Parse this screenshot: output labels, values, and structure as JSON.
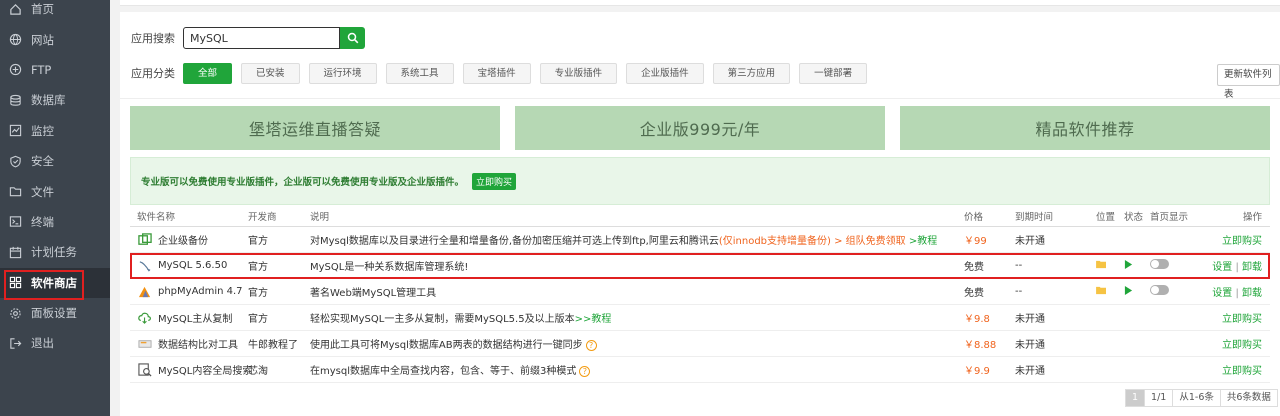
{
  "sidebar": {
    "items": [
      {
        "label": "首页",
        "icon": "home-icon"
      },
      {
        "label": "网站",
        "icon": "globe-icon"
      },
      {
        "label": "FTP",
        "icon": "ftp-icon"
      },
      {
        "label": "数据库",
        "icon": "database-icon"
      },
      {
        "label": "监控",
        "icon": "monitor-icon"
      },
      {
        "label": "安全",
        "icon": "shield-icon"
      },
      {
        "label": "文件",
        "icon": "folder-icon"
      },
      {
        "label": "终端",
        "icon": "terminal-icon"
      },
      {
        "label": "计划任务",
        "icon": "calendar-icon"
      },
      {
        "label": "软件商店",
        "icon": "grid-icon",
        "active": true
      },
      {
        "label": "面板设置",
        "icon": "gear-icon"
      },
      {
        "label": "退出",
        "icon": "logout-icon"
      }
    ]
  },
  "search": {
    "label": "应用搜索",
    "value": "MySQL"
  },
  "categories": {
    "label": "应用分类",
    "items": [
      "全部",
      "已安装",
      "运行环境",
      "系统工具",
      "宝塔插件",
      "专业版插件",
      "企业版插件",
      "第三方应用",
      "一键部署"
    ],
    "active_index": 0,
    "refresh_label": "更新软件列表"
  },
  "banners": [
    "堡塔运维直播答疑",
    "企业版999元/年",
    "精品软件推荐"
  ],
  "notice": {
    "text": "专业版可以免费使用专业版插件，企业版可以免费使用专业版及企业版插件。",
    "button": "立即购买"
  },
  "table": {
    "headers": {
      "name": "软件名称",
      "dev": "开发商",
      "desc": "说明",
      "price": "价格",
      "expire": "到期时间",
      "position": "位置",
      "status": "状态",
      "home": "首页显示",
      "op": "操作"
    },
    "rows": [
      {
        "name": "企业级备份",
        "dev": "官方",
        "desc": "对Mysql数据库以及目录进行全量和增量备份,备份加密压缩并可选上传到ftp,阿里云和腾讯云",
        "desc_red": "(仅innodb支持增量备份) > 组队免费领取",
        "desc_link": ">教程",
        "price": "￥99",
        "expire": "未开通",
        "op": "立即购买",
        "installed": false
      },
      {
        "name": "MySQL 5.6.50",
        "dev": "官方",
        "desc": "MySQL是一种关系数据库管理系统!",
        "price": "免费",
        "expire": "--",
        "op_set": "设置",
        "op_un": "卸载",
        "installed": true
      },
      {
        "name": "phpMyAdmin 4.7",
        "dev": "官方",
        "desc": "著名Web端MySQL管理工具",
        "price": "免费",
        "expire": "--",
        "op_set": "设置",
        "op_un": "卸载",
        "installed": true
      },
      {
        "name": "MySQL主从复制",
        "dev": "官方",
        "desc": "轻松实现MySQL一主多从复制，需要MySQL5.5及以上版本",
        "desc_link": ">>教程",
        "price": "￥9.8",
        "expire": "未开通",
        "op": "立即购买",
        "installed": false
      },
      {
        "name": "数据结构比对工具",
        "dev": "牛郎教程了",
        "desc": "使用此工具可将Mysql数据库AB两表的数据结构进行一键同步",
        "price": "￥8.88",
        "expire": "未开通",
        "op": "立即购买",
        "installed": false
      },
      {
        "name": "MySQL内容全局搜索",
        "dev": "芯淘",
        "desc": "在mysql数据库中全局查找内容，包含、等于、前缀3种模式",
        "price": "￥9.9",
        "expire": "未开通",
        "op": "立即购买",
        "installed": false
      }
    ]
  },
  "pager": {
    "current": "1",
    "total": "1/1",
    "range": "从1-6条",
    "count": "共6条数据"
  }
}
